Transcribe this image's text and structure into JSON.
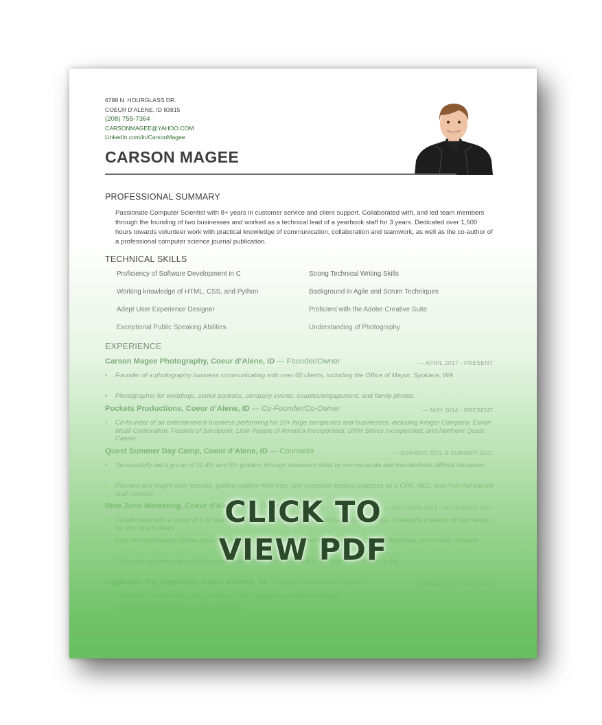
{
  "contact": {
    "address1": "6798 N. HOURGLASS DR.",
    "address2": "COEUR D’ALENE, ID 83815",
    "phone": "(208) 755-7364",
    "email": "CARSONMAGEE@YAHOO.COM",
    "linkedin": "LinkedIn.com/in/CarsonMagee"
  },
  "name": "CARSON MAGEE",
  "summary": {
    "heading": "PROFESSIONAL SUMMARY",
    "text": "Passionate Computer Scientist with 8+ years in customer service and client support. Collaborated with, and led team members through the founding of two businesses and worked as a technical lead of a yearbook staff for 3 years. Dedicated over 1,500 hours towards volunteer work with practical knowledge of communication, collaboration and teamwork, as well as the co-author of a professional computer science journal publication."
  },
  "skills": {
    "heading": "TECHNICAL SKILLS",
    "left": [
      "Proficiency of Software Development in C",
      "Working knowledge of HTML, CSS, and Python",
      "Adept User Experience Designer",
      "Exceptional Public Speaking Abilities"
    ],
    "right": [
      "Strong Technical Writing Skills",
      "Background in Agile and Scrum Techniques",
      "Proficient with the Adobe Creative Suite",
      "Understanding of Photography"
    ]
  },
  "experience": {
    "heading": "EXPERIENCE",
    "jobs": [
      {
        "company": "Carson Magee Photography, Coeur d’Alene, ID",
        "role": " — Founder/Owner",
        "date": "— APRIL 2017 - PRESENT",
        "bullets": [
          "Founder of a photography business communicating with over 60 clients, including the Office of Mayor, Spokane, WA",
          "Photographer for weddings, senior portraits, company events, couples/engagement, and family photos."
        ]
      },
      {
        "company": "Pockets Productions, Coeur d’Alene, ID",
        "role": " — Co-Founder/Co-Owner",
        "date": "— MAY 2014 - PRESENT",
        "bullets": [
          "Co-founder of an entertainment business performing for 10+ large companies and businesses, including Kroger Company, Exxon Mobil Corporation, Festival of Sandpoint, Little People of America Incorporated, URM Stores Incorporated, and Northern Quest Casino"
        ]
      },
      {
        "company": "Quest Summer Day Camp, Coeur d’Alene, ID",
        "role": " — Counselor",
        "date": "— SUMMER 2021 & SUMMER 2022",
        "bullets": [
          "Successfully led a group of 30 4th and 5th graders through teamwork skills to communicate and troubleshoot difficult situations",
          "Planned and taught daily lessons, guided outdoor field trips, and executed medical practices as a CPR, AED, and First Aid trained staff member"
        ]
      },
      {
        "company": "Blue Zone Marketing, Coeur d’Alene, ID",
        "role": " — Social Media Lead",
        "date": "— OCTOBER 2021 - DECEMBER 2021",
        "bullets": [
          "Collaborated with a group of 5 to facilitate a diverse service delivery, from branding from blogs, to website creation, to logo design, for 20+ direct clients",
          "Fully managed social media accounts, creating graphics and content from scratch in Canva, Photoshop, and similar software",
          "Time management was crucial in meeting deadlines of delivering 8 to 10 technical products a day"
        ]
      },
      {
        "company": "Figpickels Toy Emporium, Coeur d’Alene, ID",
        "role": " — Sales Clerk/Floor Expert",
        "date": "— MARCH 2018 - MAY 2020",
        "bullets": [
          "Effectively communicated with customers and displayed a product knowledge",
          "Trained new employees on store operations"
        ]
      }
    ]
  },
  "cta": {
    "line1": "CLICK TO",
    "line2": "VIEW PDF"
  }
}
